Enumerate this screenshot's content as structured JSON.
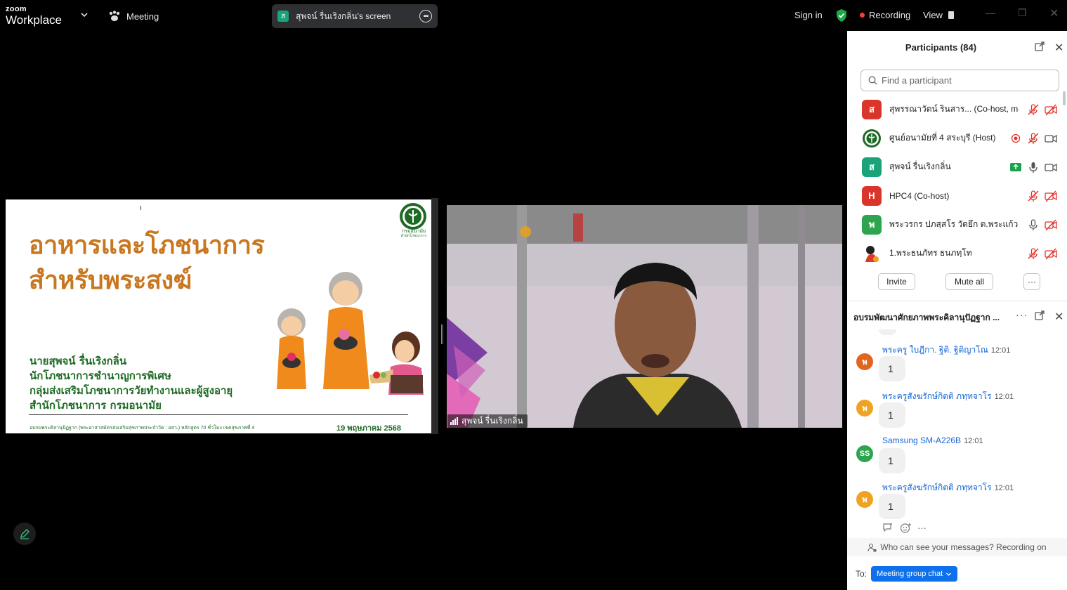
{
  "topbar": {
    "brand_small": "zoom",
    "brand_large": "Workplace",
    "meeting_label": "Meeting",
    "share_avatar": "ส",
    "share_title": "สุพจน์ รื่นเริงกลิ่น's screen",
    "sign_in": "Sign in",
    "recording_label": "Recording",
    "view_label": "View",
    "recording_color": "#ff3b30",
    "security_color": "#1ea84a"
  },
  "slide": {
    "title_line1": "อาหารและโภชนาการ",
    "title_line2": "สำหรับพระสงฆ์",
    "presenter_lines": [
      "นายสุพจน์ รื่นเริงกลิ่น",
      "นักโภชนาการชำนาญการพิเศษ",
      "กลุ่มส่งเสริมโภชนาการวัยทำงานและผู้สูงอายุ",
      "สำนักโภชนาการ กรมอนามัย"
    ],
    "footer": "อบรมพระคิลานุปัฏฐาก (พระอาสาสมัครส่งเสริมสุขภาพประจำวัด : อสว.) หลักสูตร 70 ชั่วโมง เขตสุขภาพที่ 4",
    "date": "19 พฤษภาคม 2568",
    "logo_caption_1": "กรมอนามัย",
    "logo_caption_2": "สำนักโภชนาการ",
    "accent_color": "#c9761e",
    "text_color": "#1d6a24"
  },
  "video": {
    "participant_name": "สุพจน์ รื่นเริงกลิ่น"
  },
  "participants": {
    "title": "Participants (84)",
    "search_placeholder": "Find a participant",
    "list": [
      {
        "avatar": "ส",
        "color": "#d9352b",
        "name": "สุพรรณาวัตน์ รินสาร...  (Co-host, me)"
      },
      {
        "avatar": "",
        "color": "#ffffff",
        "name": "ศูนย์อนามัยที่ 4 สระบุรี (Host)"
      },
      {
        "avatar": "ส",
        "color": "#1aa37a",
        "name": "สุพจน์ รื่นเริงกลิ่น"
      },
      {
        "avatar": "H",
        "color": "#d9352b",
        "name": "HPC4 (Co-host)"
      },
      {
        "avatar": "พ",
        "color": "#2da44e",
        "name": "พระวรกร ปภสฺสโร วัดยึก ต.พระแก้ว อ...."
      },
      {
        "avatar": "",
        "color": "#ffffff",
        "name": "1.พระธนภัทร ธนภทฺโท"
      }
    ],
    "invite_label": "Invite",
    "mute_all_label": "Mute all",
    "more_label": "···"
  },
  "chat": {
    "title": "อบรมพัฒนาศักยภาพพระคิลานุปัฏฐาก ...",
    "messages": [
      {
        "avatar": "พ",
        "color": "#e0661f",
        "name": "พระครู ใบฎีกา. ฐิติ. ฐิติญาโณ",
        "time": "12:01",
        "text": "1"
      },
      {
        "avatar": "พ",
        "color": "#f0a323",
        "name": "พระครูสังฆรักษ์กิตติ ภทฺทจาโร",
        "time": "12:01",
        "text": "1"
      },
      {
        "avatar": "SS",
        "color": "#2da44e",
        "name": "Samsung SM-A226B",
        "time": "12:01",
        "text": "1"
      },
      {
        "avatar": "พ",
        "color": "#f0a323",
        "name": "พระครูสังฆรักษ์กิตติ ภทฺทจาโร",
        "time": "12:01",
        "text": "1"
      }
    ],
    "visibility_note": "Who can see your messages? Recording on",
    "to_label": "To:",
    "recipient": "Meeting group chat"
  }
}
